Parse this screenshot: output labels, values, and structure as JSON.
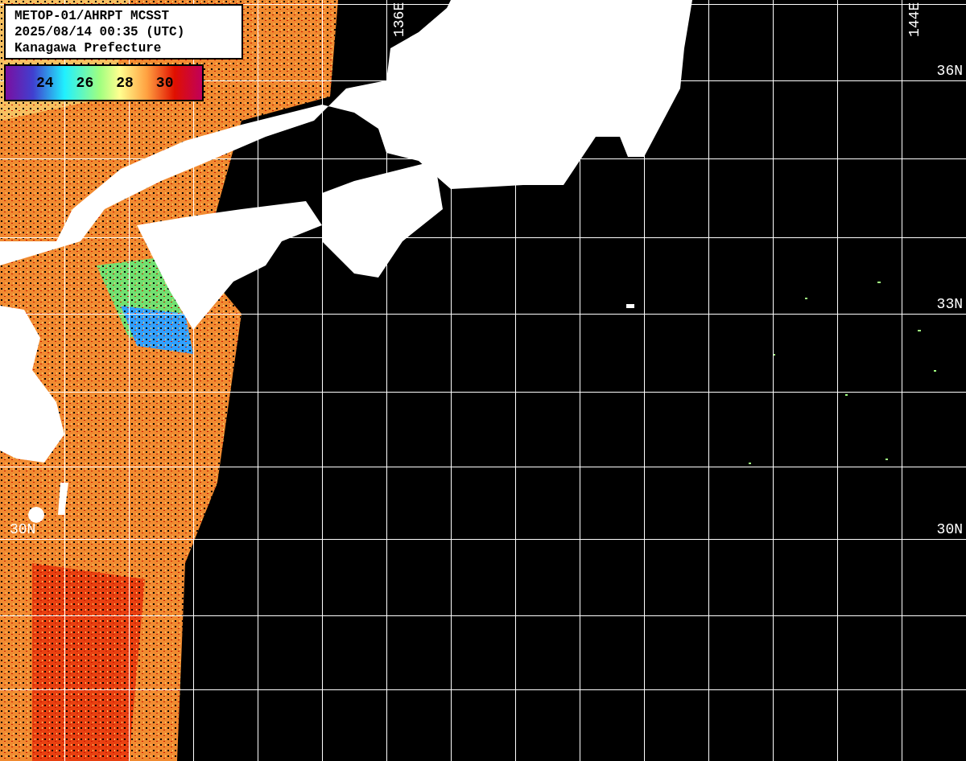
{
  "header": {
    "lines": [
      "METOP-01/AHRPT MCSST",
      "2025/08/14 00:35 (UTC)",
      "Kanagawa Prefecture"
    ]
  },
  "color_scale": {
    "ticks": [
      "24",
      "26",
      "28",
      "30"
    ]
  },
  "longitude_labels": [
    "136E",
    "144E"
  ],
  "latitude_labels_left": [
    "30N"
  ],
  "latitude_labels_right": [
    "36N",
    "33N",
    "30N"
  ]
}
